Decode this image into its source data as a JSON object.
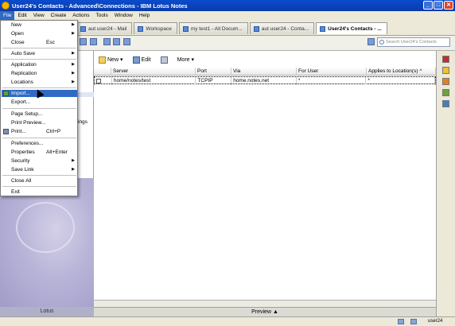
{
  "window": {
    "title": "User24's Contacts - Advanced\\Connections - IBM Lotus Notes"
  },
  "menubar": [
    "File",
    "Edit",
    "View",
    "Create",
    "Actions",
    "Tools",
    "Window",
    "Help"
  ],
  "tabs": [
    {
      "label": "aut user24 - Mail"
    },
    {
      "label": "Workspace"
    },
    {
      "label": "my test1 - All Docum..."
    },
    {
      "label": "aut user24 - Conta..."
    },
    {
      "label": "User24's Contacts - ..."
    }
  ],
  "search": {
    "placeholder": "Search User24's Contacts"
  },
  "actions": {
    "new": "New",
    "edit": "Edit",
    "more": "More"
  },
  "grid": {
    "headers": [
      "",
      "Server",
      "Port",
      "Via",
      "For User",
      "Applies to Location(s)"
    ],
    "rows": [
      [
        "",
        "home/notes/test",
        "TCPIP",
        "home.notes.net",
        "*",
        "*"
      ]
    ]
  },
  "leftpane": {
    "ings": "ings",
    "logo": "Lotus"
  },
  "preview": {
    "label": "Preview"
  },
  "status": {
    "user": "user24"
  },
  "file_menu": {
    "items": [
      {
        "label": "New",
        "shortcut": "",
        "arrow": "▶"
      },
      {
        "label": "Open",
        "shortcut": "",
        "arrow": "▶"
      },
      {
        "label": "Close",
        "shortcut": "Esc",
        "arrow": ""
      },
      {
        "label": "Auto Save",
        "shortcut": "",
        "arrow": "▶"
      },
      {
        "label": "Application",
        "shortcut": "",
        "arrow": "▶"
      },
      {
        "label": "Replication",
        "shortcut": "",
        "arrow": "▶"
      },
      {
        "label": "Locations",
        "shortcut": "",
        "arrow": "▶"
      },
      {
        "label": "Import...",
        "shortcut": "",
        "arrow": ""
      },
      {
        "label": "Export...",
        "shortcut": "",
        "arrow": ""
      },
      {
        "label": "Page Setup...",
        "shortcut": "",
        "arrow": ""
      },
      {
        "label": "Print Preview...",
        "shortcut": "",
        "arrow": ""
      },
      {
        "label": "Print...",
        "shortcut": "Ctrl+P",
        "arrow": ""
      },
      {
        "label": "Preferences...",
        "shortcut": "",
        "arrow": ""
      },
      {
        "label": "Properties",
        "shortcut": "Alt+Enter",
        "arrow": ""
      },
      {
        "label": "Security",
        "shortcut": "",
        "arrow": "▶"
      },
      {
        "label": "Save Link",
        "shortcut": "",
        "arrow": "▶"
      },
      {
        "label": "Close All",
        "shortcut": "",
        "arrow": ""
      },
      {
        "label": "Exit",
        "shortcut": "",
        "arrow": ""
      }
    ]
  }
}
